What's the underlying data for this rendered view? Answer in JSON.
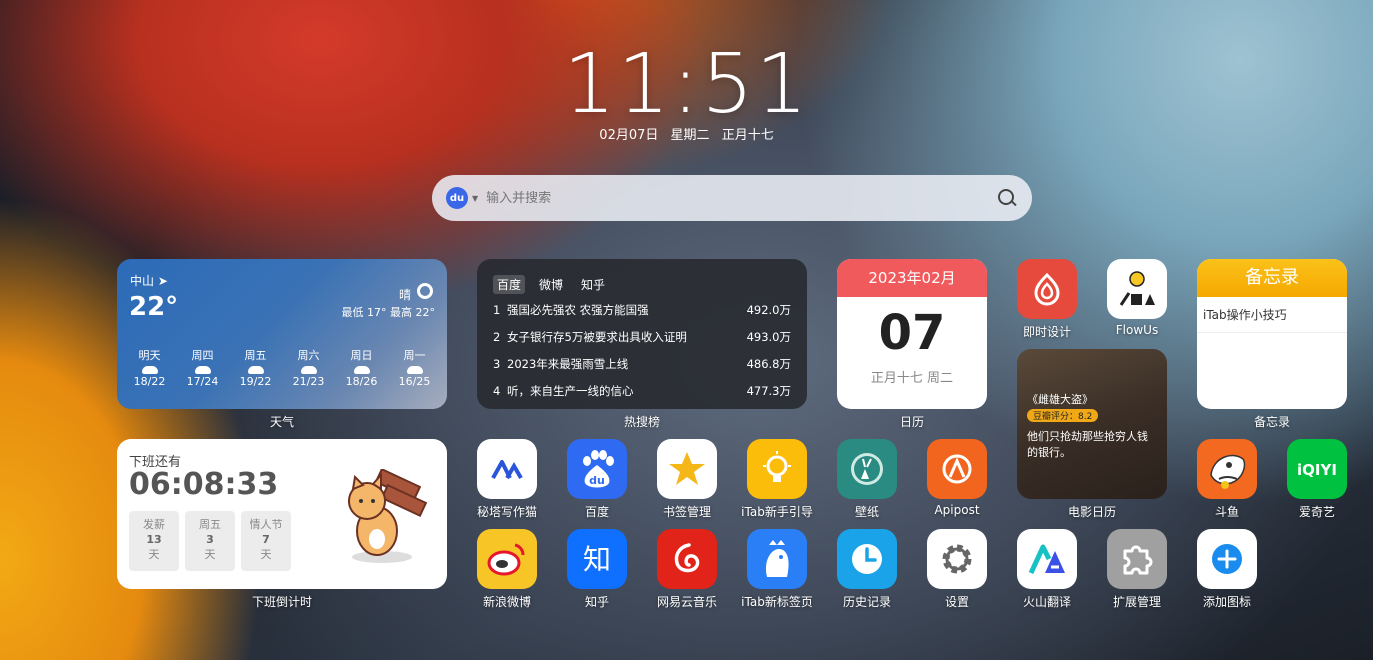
{
  "clock": {
    "time": "11:51",
    "date": "02月07日",
    "weekday": "星期二",
    "lunar": "正月十七"
  },
  "search": {
    "placeholder": "输入并搜索",
    "engine_label": "du"
  },
  "weather": {
    "caption": "天气",
    "city": "中山",
    "temp": "22°",
    "condition": "晴",
    "range": "最低 17° 最高 22°",
    "days": [
      {
        "name": "明天",
        "temps": "18/22"
      },
      {
        "name": "周四",
        "temps": "17/24"
      },
      {
        "name": "周五",
        "temps": "19/22"
      },
      {
        "name": "周六",
        "temps": "21/23"
      },
      {
        "name": "周日",
        "temps": "18/26"
      },
      {
        "name": "周一",
        "temps": "16/25"
      }
    ]
  },
  "hot": {
    "caption": "热搜榜",
    "tabs": [
      "百度",
      "微博",
      "知乎"
    ],
    "rows": [
      {
        "rank": "1",
        "title": "强国必先强农 农强方能国强",
        "count": "492.0万"
      },
      {
        "rank": "2",
        "title": "女子银行存5万被要求出具收入证明",
        "count": "493.0万"
      },
      {
        "rank": "3",
        "title": "2023年来最强雨雪上线",
        "count": "486.8万"
      },
      {
        "rank": "4",
        "title": "听，来自生产一线的信心",
        "count": "477.3万"
      }
    ]
  },
  "calendar": {
    "caption": "日历",
    "month": "2023年02月",
    "day": "07",
    "lunar": "正月十七 周二"
  },
  "memo": {
    "caption": "备忘录",
    "title": "备忘录",
    "note": "iTab操作小技巧"
  },
  "movie": {
    "caption": "电影日历",
    "title": "《雌雄大盗》",
    "score": "豆瓣评分：8.2",
    "desc": "他们只抢劫那些抢穷人钱的银行。"
  },
  "countdown": {
    "caption": "下班倒计时",
    "label": "下班还有",
    "time": "06:08:33",
    "chips": [
      {
        "name": "发薪",
        "num": "13",
        "unit": "天"
      },
      {
        "name": "周五",
        "num": "3",
        "unit": "天"
      },
      {
        "name": "情人节",
        "num": "7",
        "unit": "天"
      }
    ]
  },
  "apps": {
    "jishi": "即时设计",
    "flowus": "FlowUs",
    "mita": "秘塔写作猫",
    "baidu": "百度",
    "bookmark": "书签管理",
    "guide": "iTab新手引导",
    "wallpaper": "壁纸",
    "apipost": "Apipost",
    "douyu": "斗鱼",
    "iqiyi": "爱奇艺",
    "weibo": "新浪微博",
    "zhihu": "知乎",
    "netease": "网易云音乐",
    "newtab": "iTab新标签页",
    "history": "历史记录",
    "settings": "设置",
    "huoshan": "火山翻译",
    "extensions": "扩展管理",
    "add": "添加图标"
  },
  "colors": {
    "calendar_head": "#f15a5c",
    "memo_head": "#f5a800",
    "accent_blue": "#3a67e8"
  }
}
